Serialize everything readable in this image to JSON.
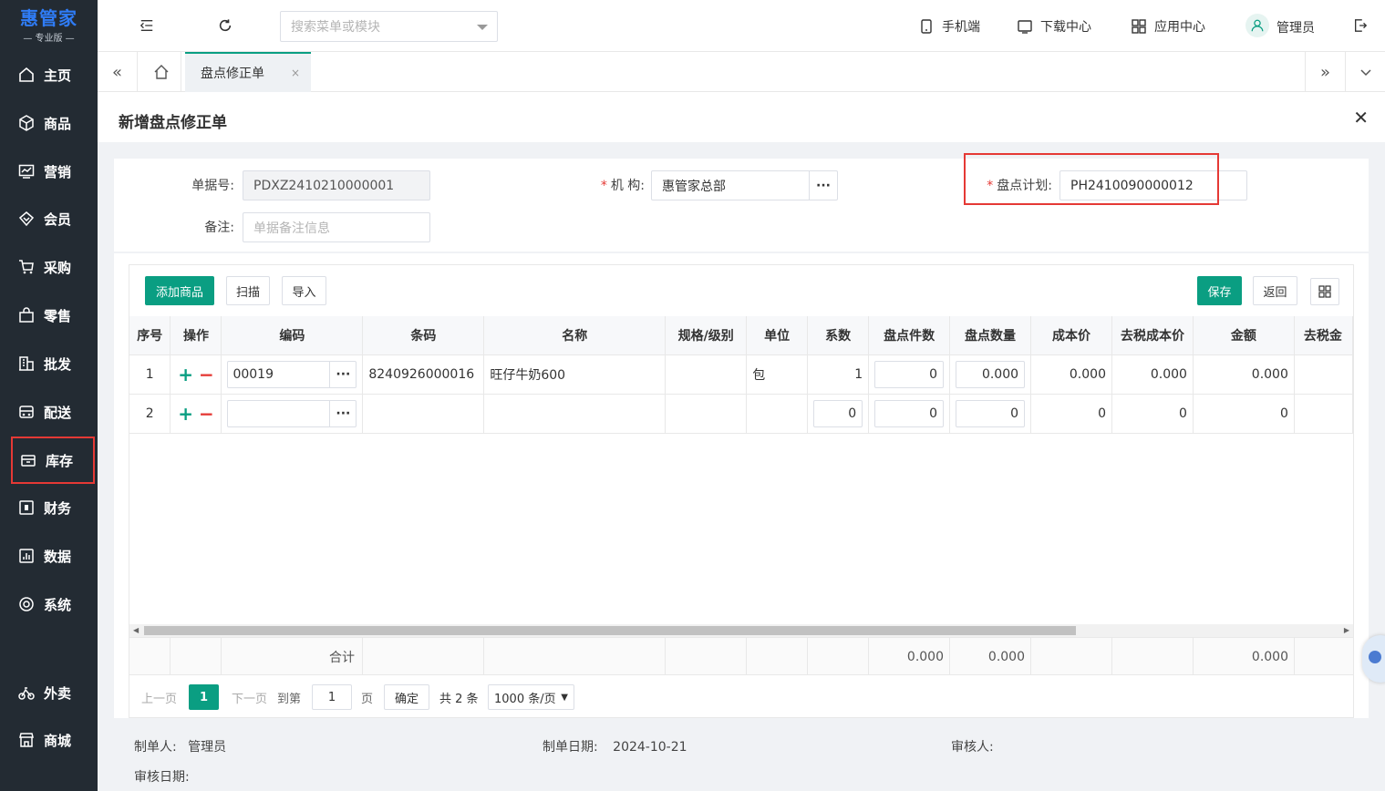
{
  "brand": {
    "name": "惠管家",
    "edition": "专业版"
  },
  "sidebar": {
    "items": [
      {
        "label": "主页",
        "icon": "home-icon"
      },
      {
        "label": "商品",
        "icon": "cube-icon"
      },
      {
        "label": "营销",
        "icon": "chart-icon"
      },
      {
        "label": "会员",
        "icon": "diamond-icon"
      },
      {
        "label": "采购",
        "icon": "cart-icon"
      },
      {
        "label": "零售",
        "icon": "bag-icon"
      },
      {
        "label": "批发",
        "icon": "building-icon"
      },
      {
        "label": "配送",
        "icon": "truck-icon"
      },
      {
        "label": "库存",
        "icon": "box-icon"
      },
      {
        "label": "财务",
        "icon": "finance-icon"
      },
      {
        "label": "数据",
        "icon": "data-icon"
      },
      {
        "label": "系统",
        "icon": "settings-icon"
      },
      {
        "label": "外卖",
        "icon": "bike-icon"
      },
      {
        "label": "商城",
        "icon": "shop-icon"
      }
    ]
  },
  "topbar": {
    "search_placeholder": "搜索菜单或模块",
    "links": {
      "mobile": "手机端",
      "download": "下载中心",
      "apps": "应用中心",
      "user": "管理员"
    }
  },
  "tabs": {
    "active": "盘点修正单",
    "close": "×"
  },
  "panel": {
    "title": "新增盘点修正单",
    "close": "✕"
  },
  "form": {
    "doc_no_label": "单据号:",
    "doc_no": "PDXZ2410210000001",
    "org_label": "机 构:",
    "org": "惠管家总部",
    "plan_label": "盘点计划:",
    "plan": "PH2410090000012",
    "remark_label": "备注:",
    "remark_placeholder": "单据备注信息",
    "required_mark": "*",
    "dots": "···"
  },
  "toolbar": {
    "add": "添加商品",
    "scan": "扫描",
    "import": "导入",
    "save": "保存",
    "back": "返回"
  },
  "grid": {
    "headers": [
      "序号",
      "操作",
      "编码",
      "条码",
      "名称",
      "规格/级别",
      "单位",
      "系数",
      "盘点件数",
      "盘点数量",
      "成本价",
      "去税成本价",
      "金额",
      "去税金"
    ],
    "plus": "+",
    "minus": "−",
    "rows": [
      {
        "no": "1",
        "code": "00019",
        "barcode": "8240926000016",
        "name": "旺仔牛奶600",
        "spec": "",
        "unit": "包",
        "factor": "1",
        "pieces": "0",
        "qty": "0.000",
        "cost": "0.000",
        "cost_notax": "0.000",
        "amount": "0.000"
      },
      {
        "no": "2",
        "code": "",
        "barcode": "",
        "name": "",
        "spec": "",
        "unit": "",
        "factor": "0",
        "pieces": "0",
        "qty": "0",
        "cost": "0",
        "cost_notax": "0",
        "amount": "0"
      }
    ],
    "summary": {
      "label": "合计",
      "pieces": "0.000",
      "qty": "0.000",
      "amount": "0.000"
    }
  },
  "pager": {
    "prev": "上一页",
    "page": "1",
    "next": "下一页",
    "goto": "到第",
    "goto_value": "1",
    "page_unit": "页",
    "confirm": "确定",
    "total": "共 2 条",
    "page_size": "1000 条/页"
  },
  "footer": {
    "creator_label": "制单人:",
    "creator": "管理员",
    "date_label": "制单日期:",
    "date": "2024-10-21",
    "auditor_label": "审核人:",
    "audit_date_label": "审核日期:"
  }
}
